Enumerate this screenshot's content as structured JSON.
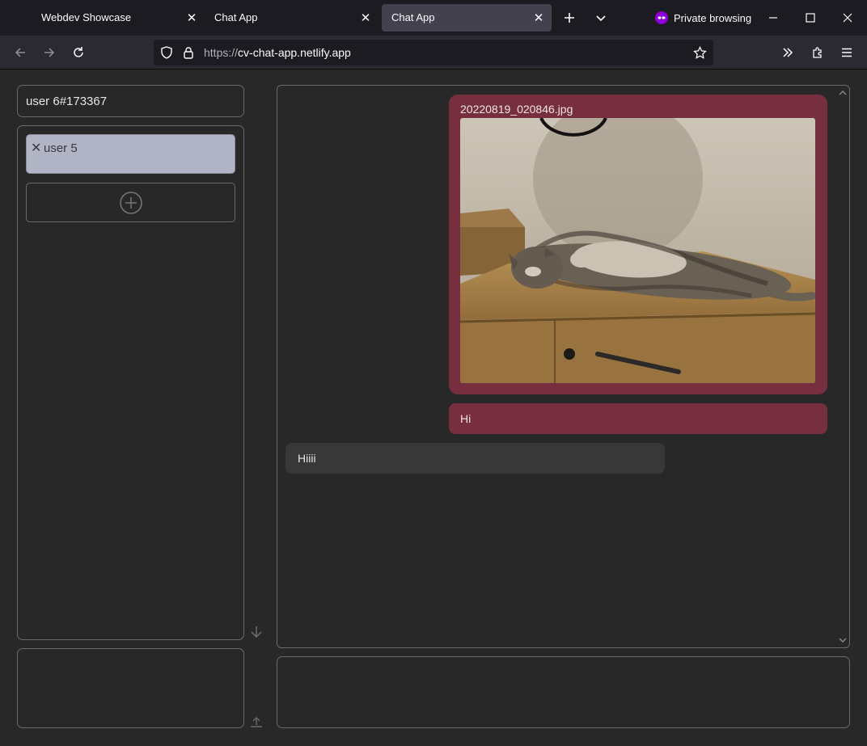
{
  "browser": {
    "tabs": [
      {
        "title": "Webdev Showcase",
        "active": false
      },
      {
        "title": "Chat App",
        "active": false
      },
      {
        "title": "Chat App",
        "active": true
      }
    ],
    "private_label": "Private browsing",
    "url_scheme": "https://",
    "url_host": "cv-chat-app.netlify.app"
  },
  "app": {
    "username": "user 6#173367",
    "contacts": [
      {
        "name": "user 5",
        "remove_icon": "close-icon"
      }
    ],
    "add_contact_icon": "plus-circle-icon",
    "messages": [
      {
        "direction": "outgoing",
        "type": "image",
        "filename": "20220819_020846.jpg"
      },
      {
        "direction": "outgoing",
        "type": "text",
        "text": "Hi"
      },
      {
        "direction": "incoming",
        "type": "text",
        "text": "Hiiii"
      }
    ]
  },
  "colors": {
    "outgoing_bubble": "#772e3e",
    "incoming_bubble": "#383838",
    "contact_selected": "#b0b4c4",
    "background": "#282828",
    "border": "#6a6a6a"
  }
}
